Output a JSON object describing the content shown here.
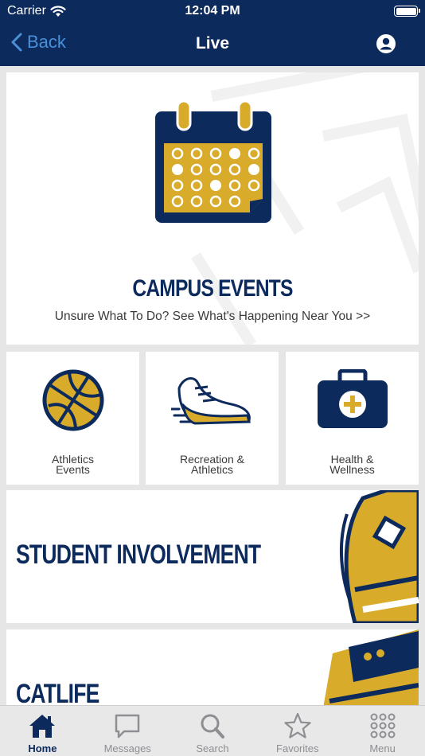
{
  "status_bar": {
    "carrier": "Carrier",
    "time": "12:04 PM"
  },
  "nav": {
    "back_label": "Back",
    "title": "Live"
  },
  "campus_events": {
    "title": "CAMPUS EVENTS",
    "subtitle": "Unsure What To Do? See What's Happening Near You >>"
  },
  "tiles": [
    {
      "label_line1": "Athletics",
      "label_line2": "Events"
    },
    {
      "label_line1": "Recreation &",
      "label_line2": "Athletics"
    },
    {
      "label_line1": "Health &",
      "label_line2": "Wellness"
    }
  ],
  "student_involvement": {
    "title": "STUDENT INVOLVEMENT"
  },
  "catlife": {
    "title": "CATLIFE"
  },
  "tab_bar": {
    "tabs": [
      {
        "label": "Home",
        "active": true
      },
      {
        "label": "Messages",
        "active": false
      },
      {
        "label": "Search",
        "active": false
      },
      {
        "label": "Favorites",
        "active": false
      },
      {
        "label": "Menu",
        "active": false
      }
    ]
  },
  "colors": {
    "navy": "#0c2a5c",
    "gold": "#d9ab2a",
    "back_blue": "#4a90d9",
    "inactive_gray": "#8e8e93"
  }
}
